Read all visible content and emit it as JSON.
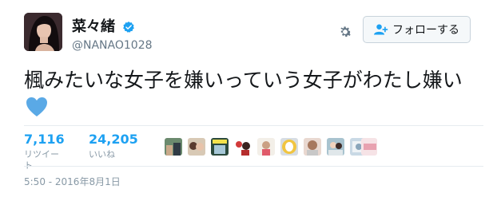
{
  "user": {
    "display_name": "菜々緒",
    "handle": "@NANAO1028",
    "verified": true
  },
  "follow_button": {
    "label": "フォローする",
    "icon": "add-user-icon"
  },
  "settings_icon": "gear-icon",
  "tweet": {
    "text": "楓みたいな女子を嫌いっていう女子がわたし嫌い",
    "emoji": "blue-heart-icon"
  },
  "stats": {
    "retweets": {
      "count": "7,116",
      "label": "リツイート"
    },
    "likes": {
      "count": "24,205",
      "label": "いいね"
    }
  },
  "likers_count": 10,
  "timestamp": "5:50 - 2016年8月1日",
  "colors": {
    "accent": "#1da1f2",
    "verified": "#1da1f2",
    "heart": "#5aa9e6",
    "muted": "#8899a6"
  }
}
